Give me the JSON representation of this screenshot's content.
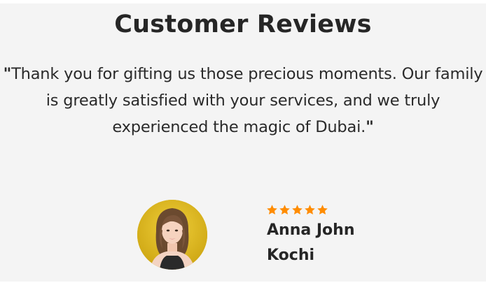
{
  "section": {
    "title": "Customer Reviews"
  },
  "review": {
    "quote_open": "\"",
    "quote_text": "Thank you for gifting us those precious moments. Our family is greatly satisfied with your services, and we truly experienced the magic of Dubai.",
    "quote_close": "\"",
    "rating": 5,
    "rating_max": 5,
    "star_color": "#ff8c00",
    "reviewer_name": "Anna John",
    "reviewer_location": "Kochi",
    "avatar_icon": "reviewer-photo"
  }
}
